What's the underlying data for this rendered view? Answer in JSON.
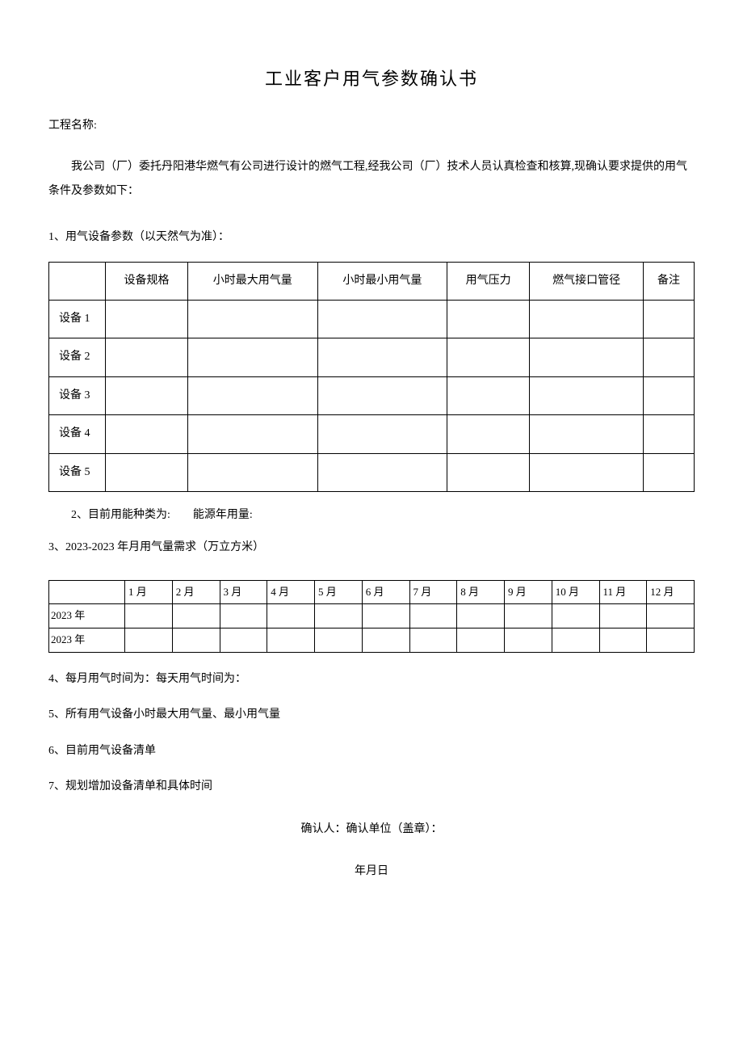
{
  "title": "工业客户用气参数确认书",
  "projectNameLabel": "工程名称:",
  "intro": "我公司（厂）委托丹阳港华燃气有公司进行设计的燃气工程,经我公司（厂）技术人员认真检查和核算,现确认要求提供的用气条件及参数如下：",
  "section1": "1、用气设备参数（以天然气为准）：",
  "equipmentTable": {
    "headers": [
      "",
      "设备规格",
      "小时最大用气量",
      "小时最小用气量",
      "用气压力",
      "燃气接口管径",
      "备注"
    ],
    "rows": [
      {
        "label": "设备 1",
        "cells": [
          "",
          "",
          "",
          "",
          "",
          ""
        ]
      },
      {
        "label": "设备 2",
        "cells": [
          "",
          "",
          "",
          "",
          "",
          ""
        ]
      },
      {
        "label": "设备 3",
        "cells": [
          "",
          "",
          "",
          "",
          "",
          ""
        ]
      },
      {
        "label": "设备 4",
        "cells": [
          "",
          "",
          "",
          "",
          "",
          ""
        ]
      },
      {
        "label": "设备 5",
        "cells": [
          "",
          "",
          "",
          "",
          "",
          ""
        ]
      }
    ]
  },
  "section2": "2、目前用能种类为:  能源年用量:",
  "section3": "3、2023-2023 年月用气量需求（万立方米）",
  "monthlyTable": {
    "headers": [
      "",
      "1 月",
      "2 月",
      "3 月",
      "4 月",
      "5 月",
      "6 月",
      "7 月",
      "8 月",
      "9 月",
      "10 月",
      "11 月",
      "12 月"
    ],
    "rows": [
      {
        "label": "2023 年",
        "cells": [
          "",
          "",
          "",
          "",
          "",
          "",
          "",
          "",
          "",
          "",
          "",
          ""
        ]
      },
      {
        "label": "2023 年",
        "cells": [
          "",
          "",
          "",
          "",
          "",
          "",
          "",
          "",
          "",
          "",
          "",
          ""
        ]
      }
    ]
  },
  "section4": "4、每月用气时间为：每天用气时间为：",
  "section5": "5、所有用气设备小时最大用气量、最小用气量",
  "section6": "6、目前用气设备清单",
  "section7": "7、规划增加设备清单和具体时间",
  "confirmLine": "确认人：确认单位（盖章）：",
  "dateLine": "年月日"
}
